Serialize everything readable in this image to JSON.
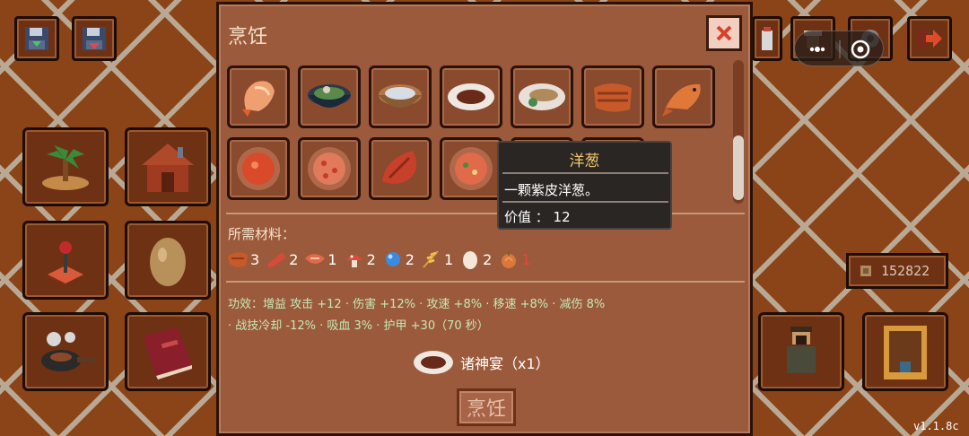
{
  "dialog": {
    "title": "烹饪",
    "cook_button_label": "烹饪"
  },
  "dishes": [
    {
      "name": "shrimp"
    },
    {
      "name": "soup-bowl"
    },
    {
      "name": "porridge-bowl"
    },
    {
      "name": "steak-plate"
    },
    {
      "name": "fish-plate"
    },
    {
      "name": "grilled-meat"
    },
    {
      "name": "fish"
    },
    {
      "name": "tomato-soup"
    },
    {
      "name": "pizza"
    },
    {
      "name": "roast-ribs"
    },
    {
      "name": "pizza-small"
    }
  ],
  "tooltip": {
    "title": "洋葱",
    "description": "一颗紫皮洋葱。",
    "value_line": "价值 ： 12"
  },
  "materials": {
    "label": "所需材料：",
    "items": [
      {
        "icon": "meat-icon",
        "qty": "3",
        "short": false
      },
      {
        "icon": "sausage-icon",
        "qty": "2",
        "short": false
      },
      {
        "icon": "fish-fillet-icon",
        "qty": "1",
        "short": false
      },
      {
        "icon": "mushroom-icon",
        "qty": "2",
        "short": false
      },
      {
        "icon": "blue-gem-icon",
        "qty": "2",
        "short": false
      },
      {
        "icon": "wheat-icon",
        "qty": "1",
        "short": false
      },
      {
        "icon": "egg-icon",
        "qty": "2",
        "short": false
      },
      {
        "icon": "onion-icon",
        "qty": "1",
        "short": true
      }
    ]
  },
  "effect": {
    "line1": "功效：增益 攻击 +12 · 伤害 +12% · 攻速 +8% · 移速 +8% · 减伤 8%",
    "line2": "· 战技冷却 -12% · 吸血 3% · 护甲 +30（70 秒）"
  },
  "result": {
    "name": "诸神宴（x1）"
  },
  "coins": "152822",
  "version": "v1.1.8c",
  "colors": {
    "background": "#8a4418",
    "dialog": "#9c5a3c",
    "effect_text": "#c5e8b8",
    "tooltip_title": "#f2c86a",
    "missing_qty": "#e04a3a"
  }
}
